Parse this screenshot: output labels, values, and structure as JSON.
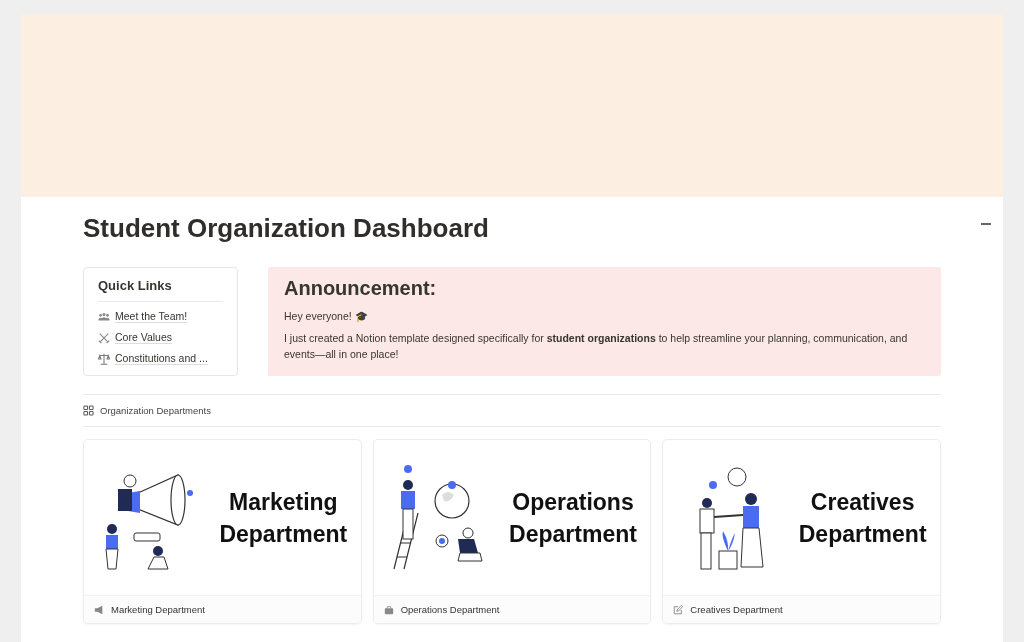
{
  "page": {
    "title": "Student Organization Dashboard"
  },
  "quick_links": {
    "title": "Quick Links",
    "items": [
      {
        "kind": "team",
        "label": "Meet the Team!"
      },
      {
        "kind": "values",
        "label": "Core Values"
      },
      {
        "kind": "scale",
        "label": "Constitutions and ..."
      }
    ]
  },
  "announcement": {
    "title": "Announcement:",
    "greeting": "Hey everyone! 🎓",
    "body": "I just created a Notion template designed specifically for **student organizations** to help streamline your planning, communication, and events—all in one place!"
  },
  "gallery": {
    "title": "Organization Departments",
    "cards": [
      {
        "kind": "marketing",
        "heading": [
          "Marketing",
          "Department"
        ],
        "caption": "Marketing Department"
      },
      {
        "kind": "operations",
        "heading": [
          "Operations",
          "Department"
        ],
        "caption": "Operations Department"
      },
      {
        "kind": "creatives",
        "heading": [
          "Creatives",
          "Department"
        ],
        "caption": "Creatives Department"
      }
    ]
  }
}
